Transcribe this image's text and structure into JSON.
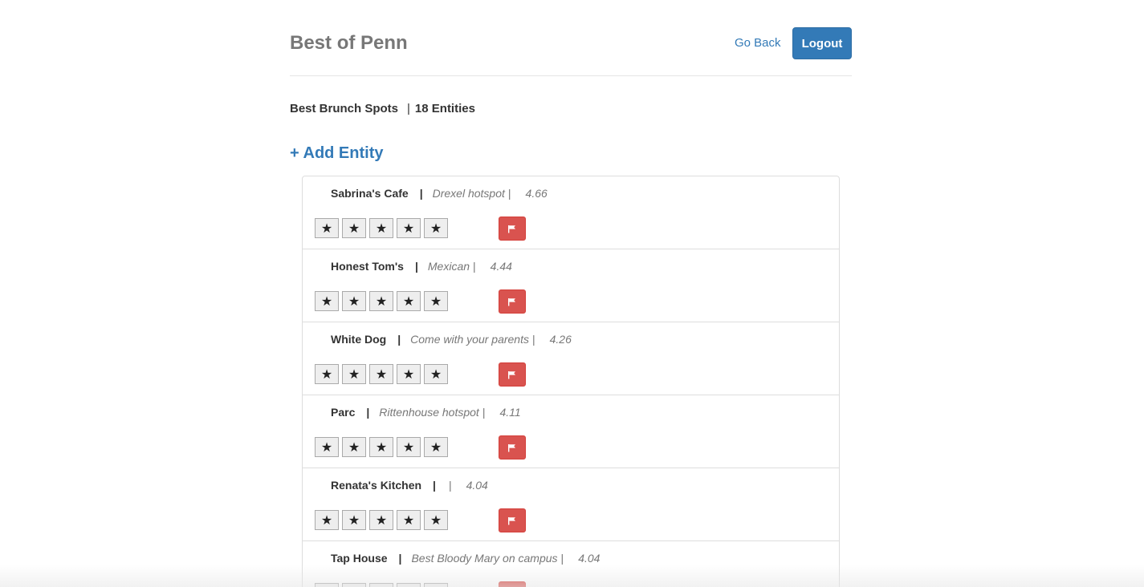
{
  "header": {
    "title": "Best of Penn",
    "go_back_label": "Go Back",
    "logout_label": "Logout"
  },
  "category": {
    "name": "Best Brunch Spots",
    "separator": "|",
    "count_label": "18 Entities"
  },
  "add_entity_label": "+ Add Entity",
  "icons": {
    "star": "star-icon",
    "flag": "flag-icon"
  },
  "colors": {
    "primary": "#337ab7",
    "danger": "#d9534f",
    "muted": "#777777"
  },
  "entities": [
    {
      "name": "Sabrina's Cafe",
      "description": "Drexel hotspot",
      "score": "4.66",
      "stars": [
        "★",
        "★",
        "★",
        "★",
        "★"
      ]
    },
    {
      "name": "Honest Tom's",
      "description": "Mexican",
      "score": "4.44",
      "stars": [
        "★",
        "★",
        "★",
        "★",
        "★"
      ]
    },
    {
      "name": "White Dog",
      "description": "Come with your parents",
      "score": "4.26",
      "stars": [
        "★",
        "★",
        "★",
        "★",
        "★"
      ]
    },
    {
      "name": "Parc",
      "description": "Rittenhouse hotspot",
      "score": "4.11",
      "stars": [
        "★",
        "★",
        "★",
        "★",
        "★"
      ]
    },
    {
      "name": "Renata's Kitchen",
      "description": "",
      "score": "4.04",
      "stars": [
        "★",
        "★",
        "★",
        "★",
        "★"
      ]
    },
    {
      "name": "Tap House",
      "description": "Best Bloody Mary on campus",
      "score": "4.04",
      "stars": [
        "★",
        "★",
        "★",
        "★",
        "★"
      ]
    }
  ]
}
